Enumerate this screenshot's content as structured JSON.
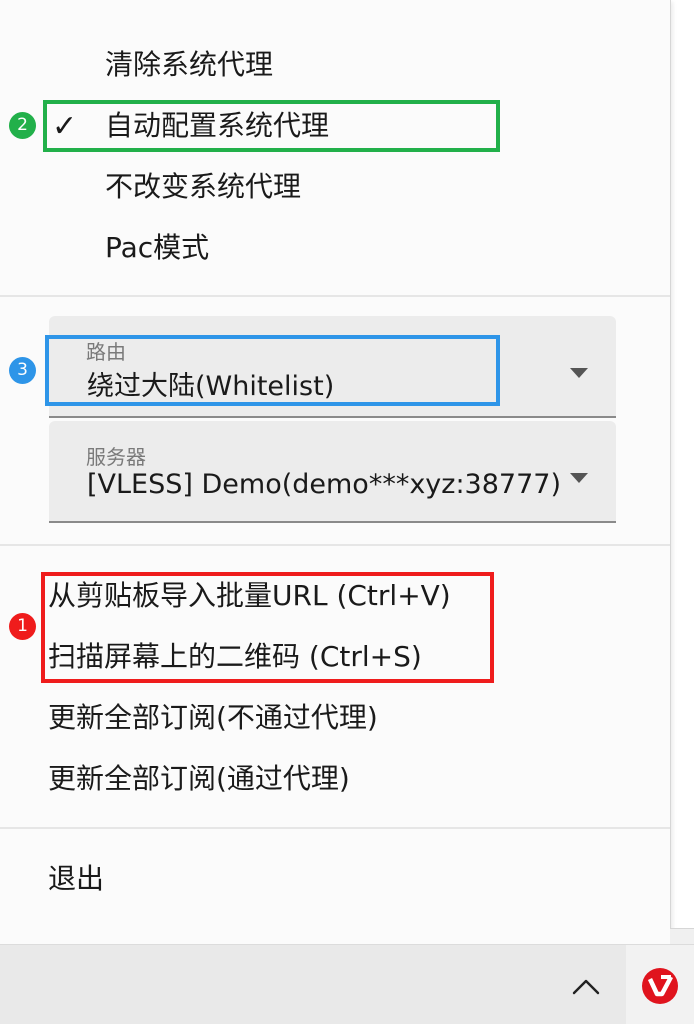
{
  "menu": {
    "proxy_modes": [
      {
        "label": "清除系统代理",
        "checked": false
      },
      {
        "label": "自动配置系统代理",
        "checked": true
      },
      {
        "label": "不改变系统代理",
        "checked": false
      },
      {
        "label": "Pac模式",
        "checked": false
      }
    ],
    "check_glyph": "✓",
    "routing": {
      "label": "路由",
      "value": "绕过大陆(Whitelist)"
    },
    "server": {
      "label": "服务器",
      "value": "[VLESS] Demo(demo***xyz:38777)"
    },
    "actions": [
      {
        "label": "从剪贴板导入批量URL (Ctrl+V)"
      },
      {
        "label": "扫描屏幕上的二维码 (Ctrl+S)"
      },
      {
        "label": "更新全部订阅(不通过代理)"
      },
      {
        "label": "更新全部订阅(通过代理)"
      }
    ],
    "exit": {
      "label": "退出"
    }
  },
  "annotations": [
    {
      "number": "1",
      "color": "#ef1c1c"
    },
    {
      "number": "2",
      "color": "#22b04a"
    },
    {
      "number": "3",
      "color": "#2e95e8"
    }
  ],
  "taskbar": {
    "tray_icons": [
      "chevron-up-icon",
      "v2rayn-tray-icon"
    ],
    "app_icon_color": "#e0141e"
  }
}
